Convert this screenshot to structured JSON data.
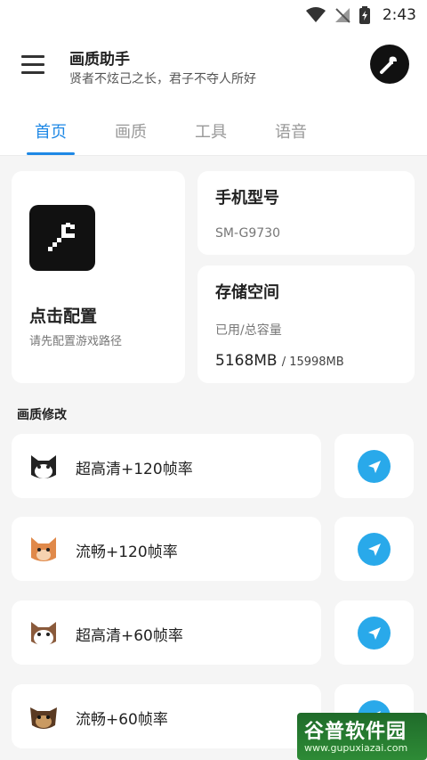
{
  "status_bar": {
    "time": "2:43"
  },
  "header": {
    "title": "画质助手",
    "subtitle": "贤者不炫己之长，君子不夺人所好"
  },
  "tabs": [
    {
      "label": "首页",
      "active": true
    },
    {
      "label": "画质",
      "active": false
    },
    {
      "label": "工具",
      "active": false
    },
    {
      "label": "语音",
      "active": false
    }
  ],
  "config_card": {
    "title": "点击配置",
    "subtitle": "请先配置游戏路径"
  },
  "phone_model_card": {
    "title": "手机型号",
    "value": "SM-G9730"
  },
  "storage_card": {
    "title": "存储空间",
    "caption": "已用/总容量",
    "used": "5168MB",
    "total": "/ 15998MB"
  },
  "quality_section": {
    "title": "画质修改",
    "presets": [
      {
        "label": "超高清+120帧率",
        "icon": "cat-icon"
      },
      {
        "label": "流畅+120帧率",
        "icon": "cat-icon"
      },
      {
        "label": "超高清+60帧率",
        "icon": "cat-icon"
      },
      {
        "label": "流畅+60帧率",
        "icon": "dog-icon"
      }
    ]
  },
  "watermark": {
    "title": "谷普软件园",
    "url": "www.gupuxiazai.com"
  },
  "colors": {
    "accent": "#1e88e5",
    "apply_button": "#29a9ea",
    "background": "#f5f5f5"
  }
}
